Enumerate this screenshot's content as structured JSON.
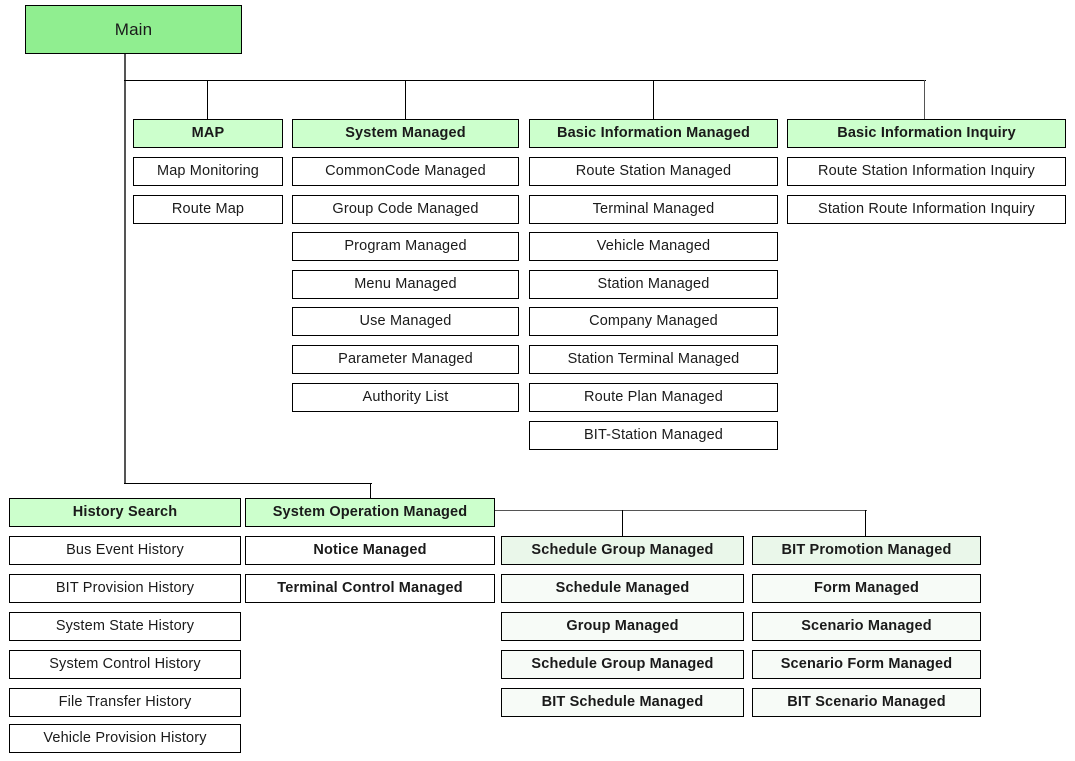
{
  "diagram": {
    "title": "Main",
    "root": {
      "label": "Main"
    },
    "groups": [
      {
        "id": "map",
        "header": "MAP",
        "items": [
          "Map Monitoring",
          "Route Map"
        ]
      },
      {
        "id": "system-managed",
        "header": "System Managed",
        "items": [
          "CommonCode Managed",
          "Group Code Managed",
          "Program Managed",
          "Menu Managed",
          "Use Managed",
          "Parameter Managed",
          "Authority List"
        ]
      },
      {
        "id": "basic-information-managed",
        "header": "Basic Information Managed",
        "items": [
          "Route Station Managed",
          "Terminal Managed",
          "Vehicle Managed",
          "Station Managed",
          "Company Managed",
          "Station Terminal Managed",
          "Route Plan Managed",
          "BIT-Station Managed"
        ]
      },
      {
        "id": "basic-information-inquiry",
        "header": "Basic Information Inquiry",
        "items": [
          "Route Station Information Inquiry",
          "Station Route Information Inquiry"
        ]
      },
      {
        "id": "history-search",
        "header": "History Search",
        "items": [
          "Bus Event History",
          "BIT Provision History",
          "System State History",
          "System Control History",
          "File Transfer History",
          "Vehicle Provision History"
        ]
      },
      {
        "id": "system-operation-managed",
        "header": "System Operation Managed",
        "items": [
          "Notice Managed",
          "Terminal Control Managed"
        ]
      },
      {
        "id": "schedule-group-managed",
        "header": "Schedule Group Managed",
        "items": [
          "Schedule Managed",
          "Group Managed",
          "Schedule Group Managed",
          "BIT Schedule Managed"
        ]
      },
      {
        "id": "bit-promotion-managed",
        "header": "BIT Promotion Managed",
        "items": [
          "Form Managed",
          "Scenario Managed",
          "Scenario Form Managed",
          "BIT Scenario Managed"
        ]
      }
    ],
    "colors": {
      "root_fill": "#90ee90",
      "header_fill": "#ccffcc",
      "tint_header_fill": "#eaf7ea",
      "tint_fill": "#f7fbf7",
      "box_fill": "#ffffff",
      "border": "#000000",
      "text": "#1a1a1a",
      "background": "#ffffff"
    }
  }
}
